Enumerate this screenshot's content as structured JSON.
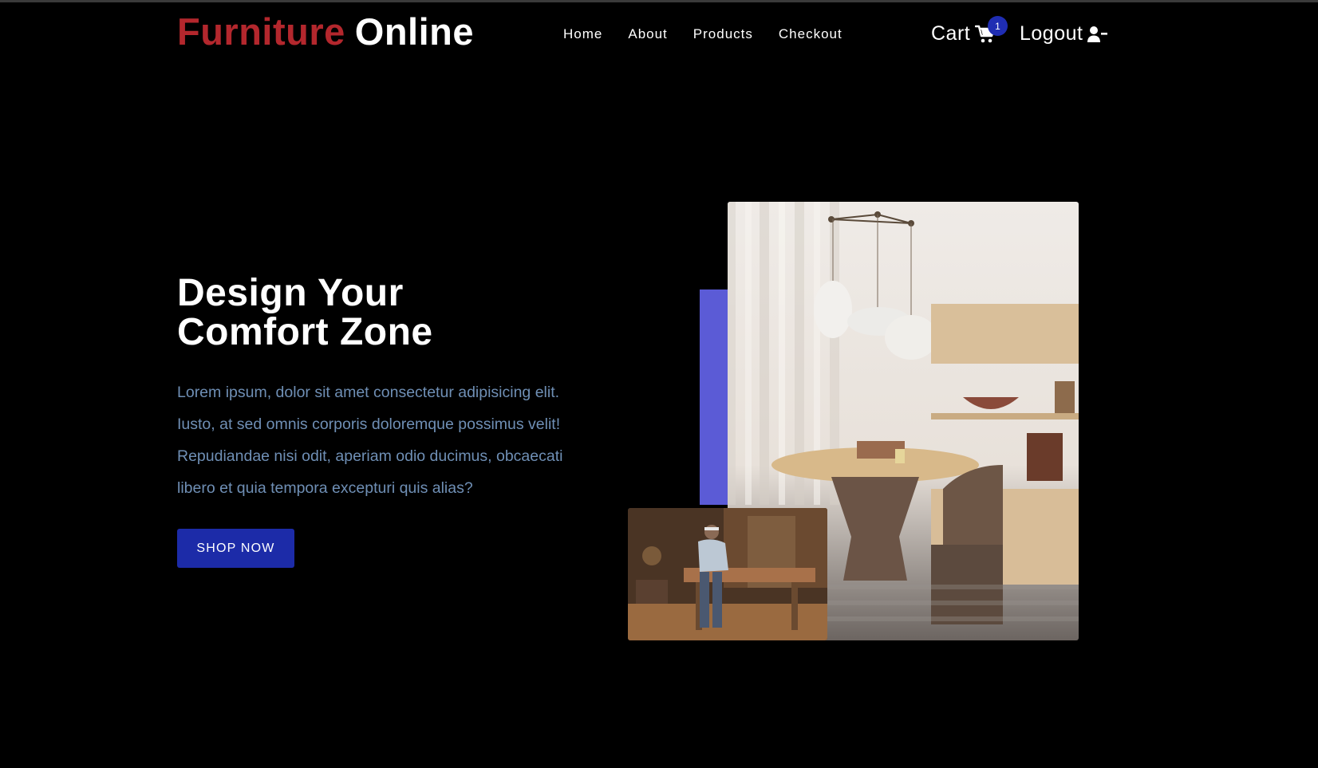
{
  "header": {
    "logo_brand": "Furniture",
    "logo_rest": "Online",
    "nav": [
      "Home",
      "About",
      "Products",
      "Checkout"
    ],
    "cart_label": "Cart",
    "cart_count": "1",
    "logout_label": "Logout"
  },
  "hero": {
    "title_line1": "Design Your",
    "title_line2": "Comfort Zone",
    "text_lines": [
      "Lorem ipsum, dolor sit amet consectetur adipisicing elit.",
      "Iusto, at sed omnis corporis doloremque possimus velit!",
      "Repudiandae nisi odit, aperiam odio ducimus, obcaecati",
      "libero et quia tempora excepturi quis alias?"
    ],
    "cta_label": "SHOP NOW"
  },
  "icons": {
    "cart": "shopping-cart-icon",
    "logout": "user-minus-icon"
  },
  "colors": {
    "background": "#000000",
    "brand_red": "#b3272d",
    "primary_blue": "#1c2ba8",
    "accent_purple": "#5b5bd6",
    "body_text": "#6f8fb5",
    "badge_blue": "#1f2db3"
  }
}
